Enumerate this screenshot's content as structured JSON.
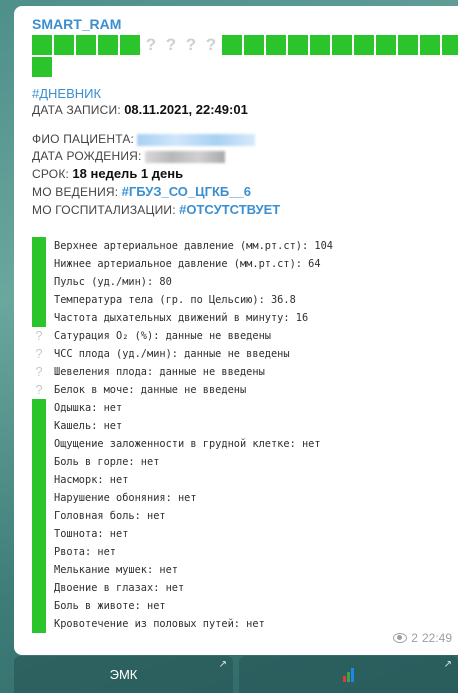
{
  "message": {
    "sender": "SMART_RAM",
    "progress": [
      "g",
      "g",
      "g",
      "g",
      "g",
      "q",
      "q",
      "q",
      "q",
      "g",
      "g",
      "g",
      "g",
      "g",
      "g",
      "g",
      "g",
      "g",
      "g",
      "g",
      "g"
    ],
    "tag": "#ДНЕВНИК",
    "record_date_label": "ДАТА ЗАПИСИ:",
    "record_date_value": "08.11.2021, 22:49:01",
    "patient_label": "ФИО ПАЦИЕНТА:",
    "birth_label": "ДАТА РОЖДЕНИЯ:",
    "term_label": "СРОК:",
    "term_value": "18 недель 1 день",
    "mo_label": "МО ВЕДЕНИЯ:",
    "mo_value": "#ГБУЗ_СО_ЦГКБ__6",
    "hosp_label": "МО ГОСПИТАЛИЗАЦИИ:",
    "hosp_value": "#ОТСУТСТВУЕТ",
    "items": [
      {
        "mark": "g",
        "text": "Верхнее артериальное давление (мм.рт.ст): 104"
      },
      {
        "mark": "g",
        "text": "Нижнее артериальное давление (мм.рт.ст): 64"
      },
      {
        "mark": "g",
        "text": "Пульс (уд./мин): 80"
      },
      {
        "mark": "g",
        "text": "Температура тела (гр. по Цельсию): 36.8"
      },
      {
        "mark": "g",
        "text": "Частота дыхательных движений в минуту: 16"
      },
      {
        "mark": "q",
        "text": "Сатурация O₂ (%): данные не введены"
      },
      {
        "mark": "q",
        "text": "ЧСС плода (уд./мин): данные не введены"
      },
      {
        "mark": "q",
        "text": "Шевеления плода: данные не введены"
      },
      {
        "mark": "q",
        "text": "Белок в моче: данные не введены"
      },
      {
        "mark": "g",
        "text": "Одышка: нет"
      },
      {
        "mark": "g",
        "text": "Кашель: нет"
      },
      {
        "mark": "g",
        "text": "Ощущение заложенности в грудной клетке: нет"
      },
      {
        "mark": "g",
        "text": "Боль в горле: нет"
      },
      {
        "mark": "g",
        "text": "Насморк: нет"
      },
      {
        "mark": "g",
        "text": "Нарушение обоняния: нет"
      },
      {
        "mark": "g",
        "text": "Головная боль: нет"
      },
      {
        "mark": "g",
        "text": "Тошнота: нет"
      },
      {
        "mark": "g",
        "text": "Рвота: нет"
      },
      {
        "mark": "g",
        "text": "Мелькание мушек: нет"
      },
      {
        "mark": "g",
        "text": "Двоение в глазах: нет"
      },
      {
        "mark": "g",
        "text": "Боль в животе: нет"
      },
      {
        "mark": "g",
        "text": "Кровотечение из половых путей: нет"
      }
    ],
    "views": "2",
    "time": "22:49"
  },
  "buttons": {
    "emk_label": "ЭМК",
    "arrow": "↗",
    "chart_icon": "bar-chart-icon"
  },
  "colors": {
    "accent": "#3a8fd0",
    "green": "#2bc52b"
  }
}
